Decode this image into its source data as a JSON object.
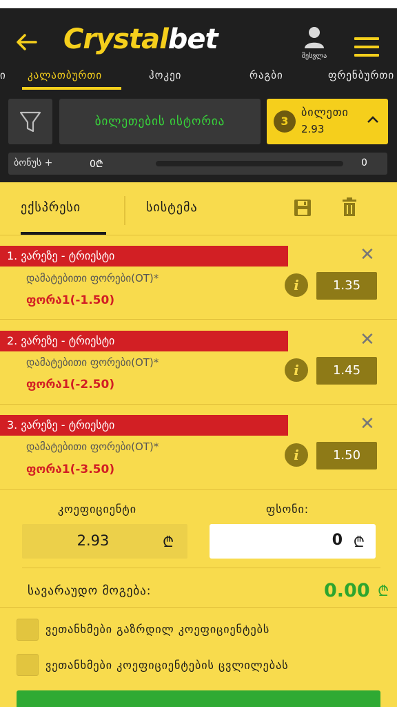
{
  "header": {
    "back_label": "←",
    "logo_main": "Crystal",
    "logo_accent": "bet",
    "login_label": "შესვლა"
  },
  "sports_tabs": [
    {
      "label": "ი"
    },
    {
      "label": "კალათბურთი",
      "active": true
    },
    {
      "label": "ჰოკეი"
    },
    {
      "label": "რაგბი"
    },
    {
      "label": "ფრენბურთი"
    }
  ],
  "betslip_bar": {
    "history_label": "ბილეთების ისტორია",
    "ticket_count": "3",
    "ticket_label": "ბილეთი",
    "ticket_odds": "2.93"
  },
  "bonus": {
    "label": "ბონუს +",
    "amount": "0₾",
    "progress": 0,
    "value": "0"
  },
  "bet_types": {
    "express": "ექსპრესი",
    "system": "სისტემა"
  },
  "selections": [
    {
      "title": "1.  ვარეზე - ტრიესტი",
      "market": "დამატებითი ფორები(OT)*",
      "pick": "ფორა1(-1.50)",
      "odd": "1.35"
    },
    {
      "title": "2.  ვარეზე - ტრიესტი",
      "market": "დამატებითი ფორები(OT)*",
      "pick": "ფორა1(-2.50)",
      "odd": "1.45"
    },
    {
      "title": "3.  ვარეზე - ტრიესტი",
      "market": "დამატებითი ფორები(OT)*",
      "pick": "ფორა1(-3.50)",
      "odd": "1.50"
    }
  ],
  "summary": {
    "coef_label": "კოეფიციენტი",
    "coef_value": "2.93",
    "currency": "₾",
    "stake_label": "ფსონი:",
    "stake_value": "0",
    "win_label": "სავარაუდო მოგება:",
    "win_value": "0.00"
  },
  "checks": [
    {
      "label": "ვეთანხმები გაზრდილ კოეფიციენტებს"
    },
    {
      "label": "ვეთანხმები კოეფიციენტების ცვლილებას"
    }
  ],
  "colors": {
    "accent": "#f5cf1c",
    "dark": "#1f1f1f",
    "red": "#d21f24",
    "green": "#2ea52e"
  }
}
